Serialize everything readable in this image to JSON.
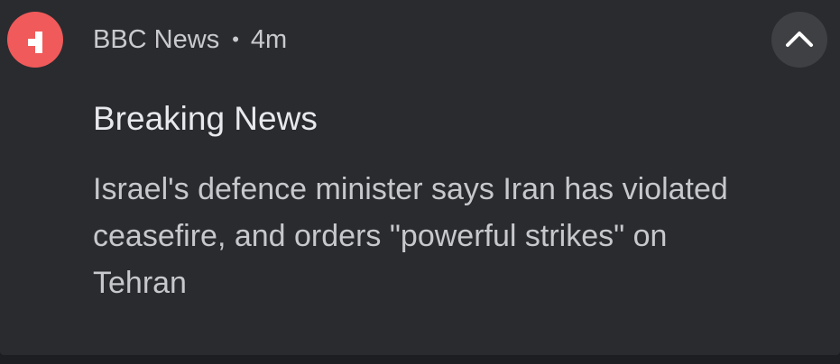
{
  "notification": {
    "app_name": "BBC News",
    "separator": "•",
    "time_ago": "4m",
    "title": "Breaking News",
    "body_lines": [
      "Israel's defence minister says Iran has violated",
      "ceasefire, and orders \"powerful strikes\" on",
      "Tehran"
    ],
    "app_icon": "bbc-news-glyph-icon",
    "expand_icon": "chevron-up-icon"
  },
  "colors": {
    "card_background": "#2a2b2f",
    "app_icon_background": "#f05a5a",
    "expand_button_background": "#3e4044",
    "title_text": "#e8e9ec",
    "secondary_text": "#c9cacd"
  }
}
